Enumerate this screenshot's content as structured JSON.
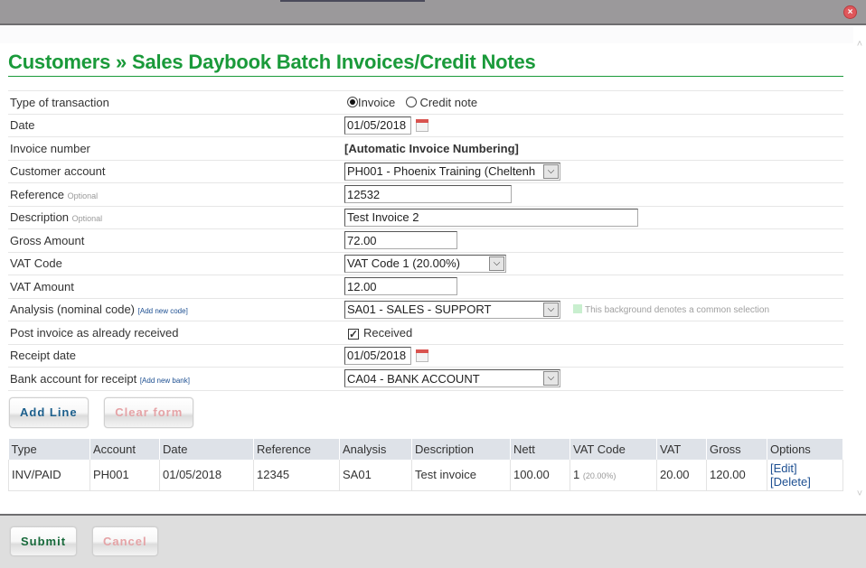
{
  "window": {
    "close_icon": "×"
  },
  "page": {
    "title": "Customers » Sales Daybook Batch Invoices/Credit Notes"
  },
  "form": {
    "type_label": "Type of transaction",
    "type_options": [
      {
        "label": "Invoice",
        "checked": true
      },
      {
        "label": "Credit note",
        "checked": false
      }
    ],
    "date_label": "Date",
    "date_value": "01/05/2018",
    "invoice_number_label": "Invoice number",
    "invoice_number_value": "[Automatic Invoice Numbering]",
    "customer_label": "Customer account",
    "customer_value": "PH001 - Phoenix Training (Cheltenh",
    "reference_label": "Reference",
    "reference_optional": "Optional",
    "reference_value": "12532",
    "description_label": "Description",
    "description_optional": "Optional",
    "description_value": "Test Invoice 2",
    "gross_label": "Gross Amount",
    "gross_value": "72.00",
    "vat_code_label": "VAT Code",
    "vat_code_value": "VAT Code 1 (20.00%)",
    "vat_amount_label": "VAT Amount",
    "vat_amount_value": "12.00",
    "analysis_label": "Analysis (nominal code)",
    "analysis_link": "[Add new code]",
    "analysis_value": "SA01 - SALES - SUPPORT",
    "common_selection_note": "This background denotes a common selection",
    "post_received_label": "Post invoice as already received",
    "received_checkbox_label": "Received",
    "received_checked": true,
    "receipt_date_label": "Receipt date",
    "receipt_date_value": "01/05/2018",
    "bank_label": "Bank account for receipt",
    "bank_link": "[Add new bank]",
    "bank_value": "CA04 - BANK ACCOUNT",
    "checkmark": "✓",
    "dropdown_arrow": "⌵"
  },
  "actions": {
    "add_line": "Add Line",
    "clear_form": "Clear form"
  },
  "grid": {
    "columns": [
      "Type",
      "Account",
      "Date",
      "Reference",
      "Analysis",
      "Description",
      "Nett",
      "VAT Code",
      "VAT",
      "Gross",
      "Options"
    ],
    "rows": [
      {
        "type": "INV/PAID",
        "account": "PH001",
        "date": "01/05/2018",
        "reference": "12345",
        "analysis": "SA01",
        "description": "Test invoice",
        "nett": "100.00",
        "vat_code": "1",
        "vat_pct": "(20.00%)",
        "vat": "20.00",
        "gross": "120.00",
        "edit": "[Edit]",
        "delete": "[Delete]"
      }
    ]
  },
  "footer": {
    "submit": "Submit",
    "cancel": "Cancel"
  },
  "scroll": {
    "up": "˄",
    "down": "˅"
  },
  "colors": {
    "title_green": "#1a9a3a",
    "link_blue": "#1d4f91",
    "header_row": "#dee2e8",
    "common_selection": "#c9efcf"
  }
}
